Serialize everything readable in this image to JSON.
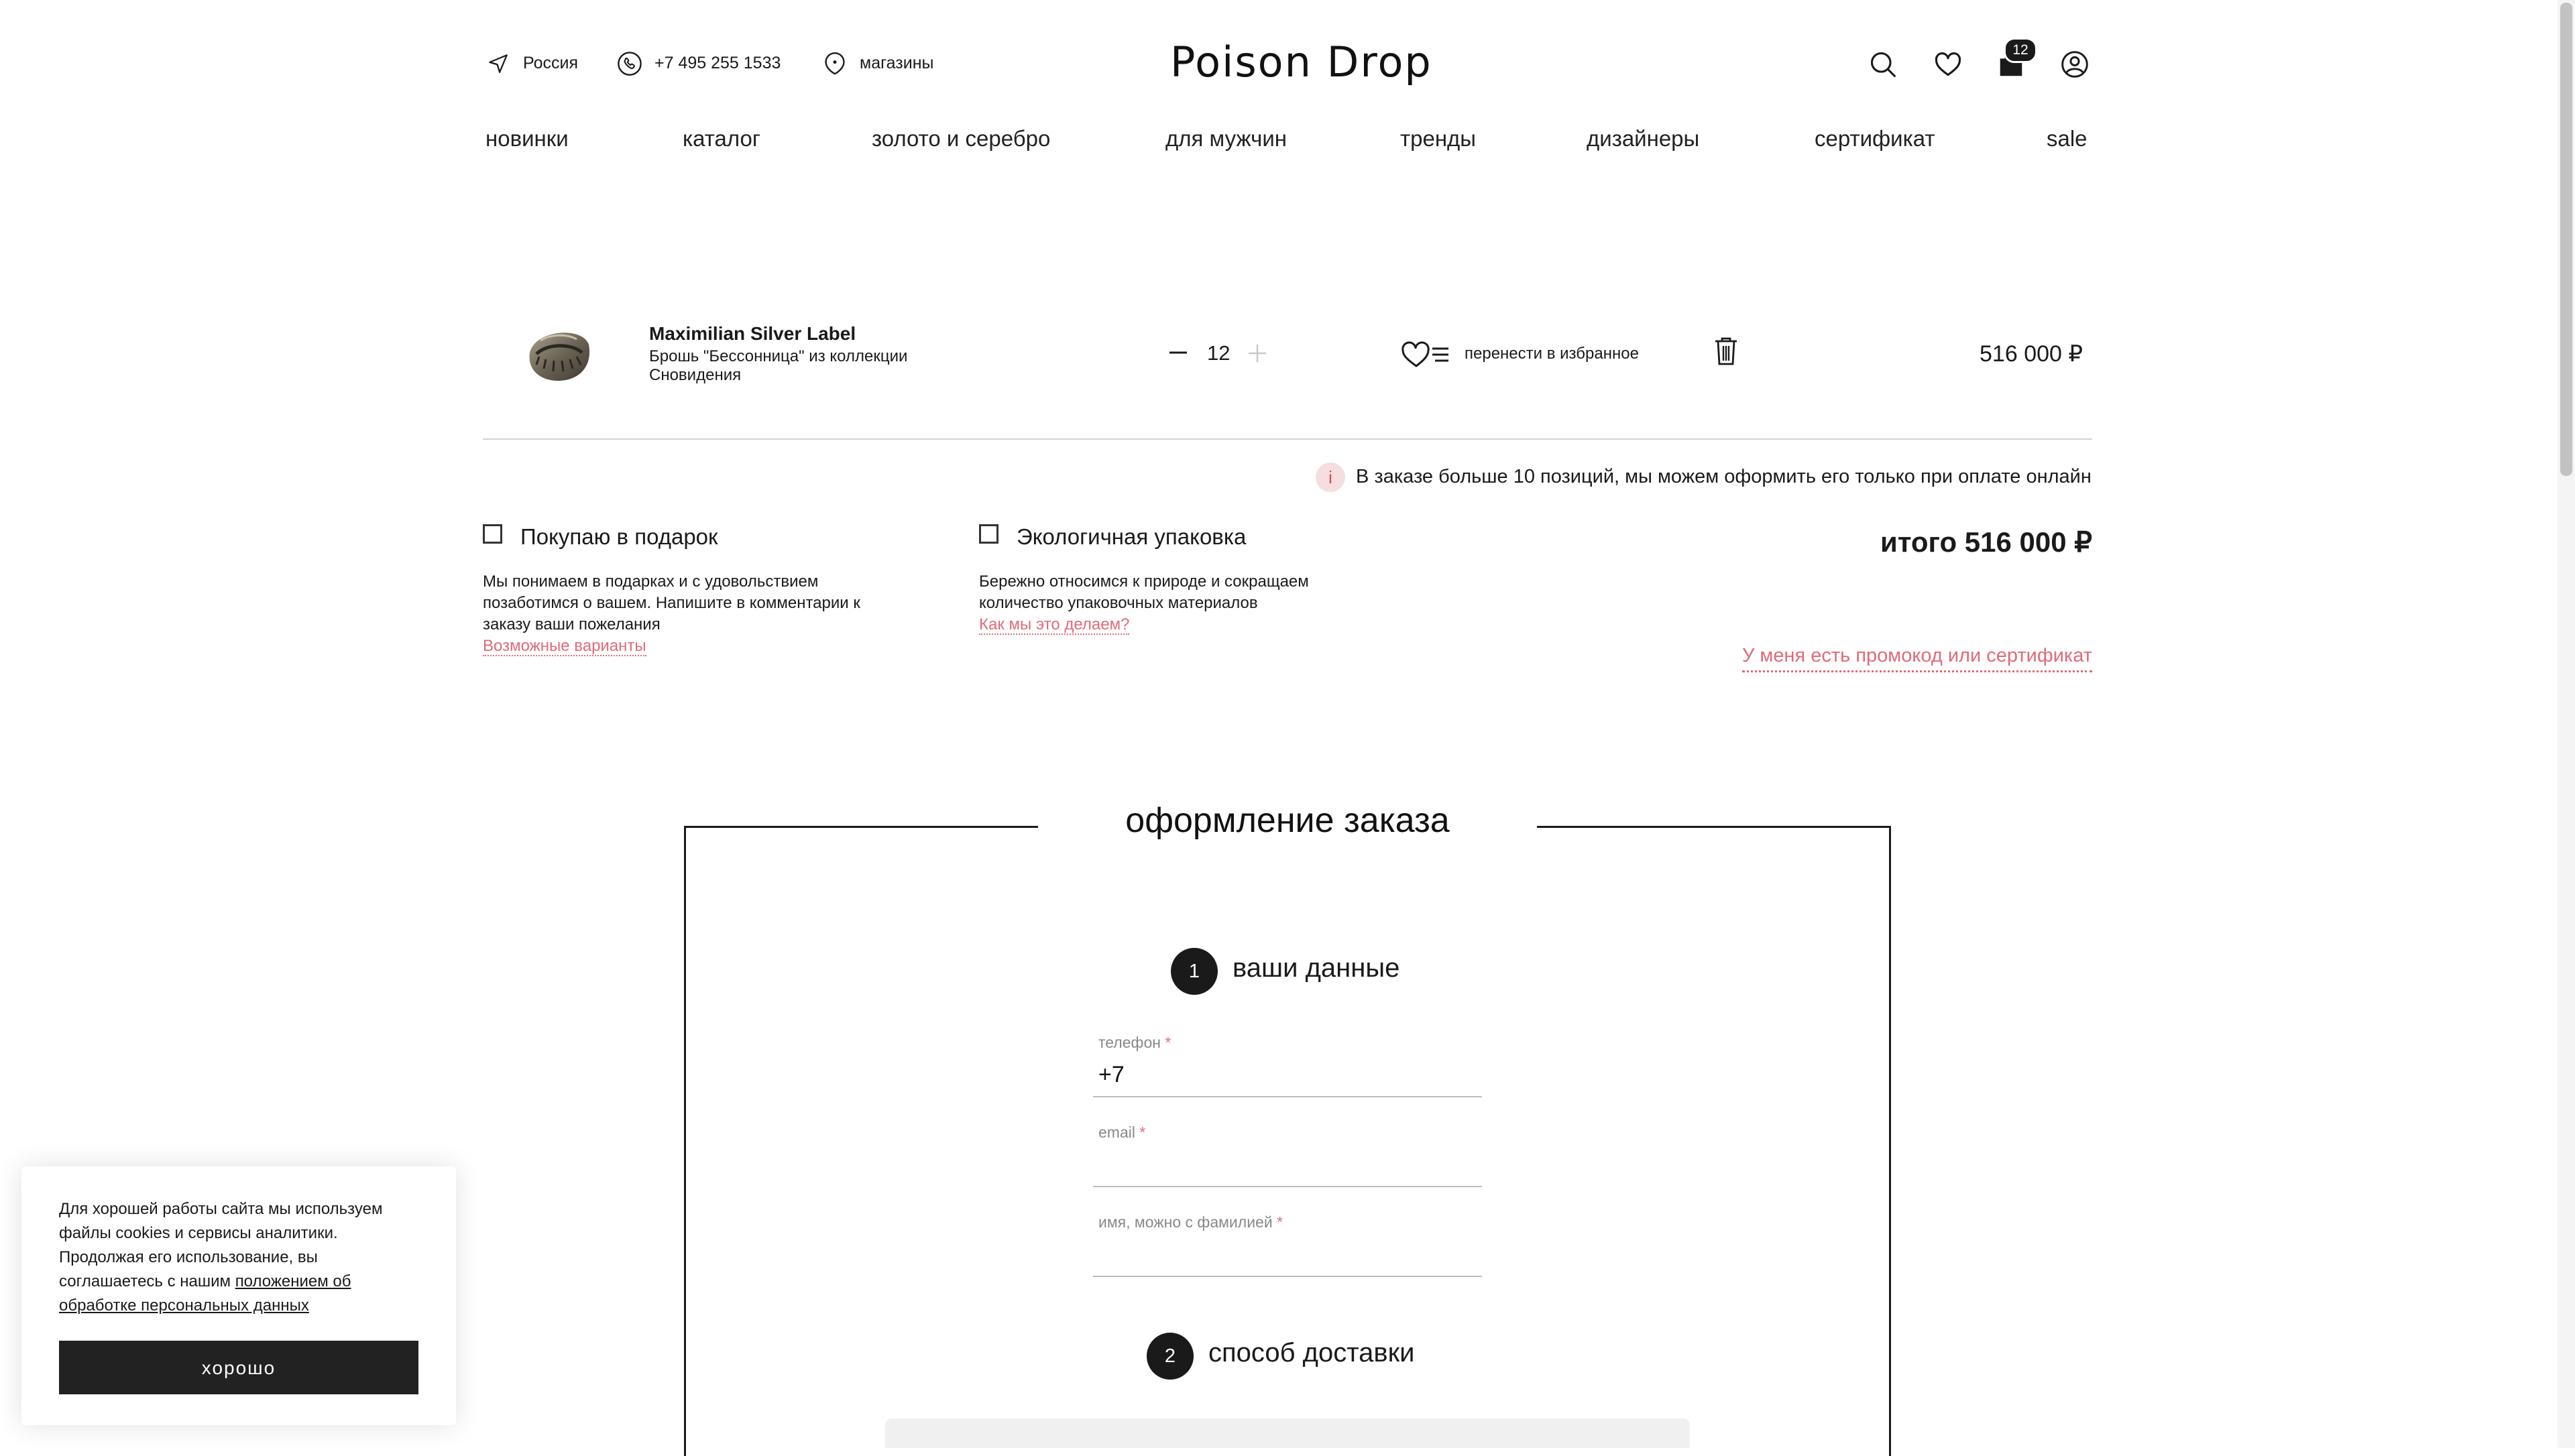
{
  "header": {
    "region": "Россия",
    "phone": "+7 495 255 1533",
    "stores": "магазины",
    "logo": "Poison Drop",
    "cart_count": "12"
  },
  "nav": [
    "новинки",
    "каталог",
    "золото и серебро",
    "для мужчин",
    "тренды",
    "дизайнеры",
    "сертификат",
    "sale"
  ],
  "cart": {
    "item": {
      "brand": "Maximilian Silver Label",
      "desc_line1": "Брошь \"Бессонница\" из коллекции",
      "desc_line2": "Сновидения",
      "qty": "12",
      "move_to_favorites": "перенести в избранное",
      "price": "516 000 ₽"
    },
    "notice": "В заказе больше 10 позиций, мы можем оформить его только при оплате онлайн",
    "notice_icon": "i",
    "gift": {
      "label": "Покупаю в подарок",
      "line1": "Мы понимаем в подарках и с удовольствием",
      "line2": "позаботимся о вашем. Напишите в комментарии к",
      "line3": "заказу ваши пожелания",
      "link": "Возможные варианты"
    },
    "eco": {
      "label": "Экологичная упаковка",
      "line1": "Бережно относимся к природе и сокращаем",
      "line2": "количество упаковочных материалов",
      "link": "Как мы это делаем?"
    },
    "total": "итого 516 000 ₽",
    "promo": "У меня есть промокод или сертификат"
  },
  "order": {
    "title": "оформление заказа",
    "step1": {
      "num": "1",
      "title": "ваши данные"
    },
    "fields": {
      "phone": {
        "label": "телефон",
        "value": "+7"
      },
      "email": {
        "label": "email",
        "value": ""
      },
      "name": {
        "label": "имя, можно с фамилией",
        "value": ""
      },
      "required_mark": "*"
    },
    "step2": {
      "num": "2",
      "title": "способ доставки"
    }
  },
  "cookies": {
    "line1": "Для хорошей работы сайта мы используем",
    "line2": "файлы cookies и сервисы аналитики.",
    "line3": "Продолжая его использование, вы",
    "line4": "соглашаетесь с нашим ",
    "link1": "положением об",
    "link2": "обработке персональных данных",
    "button": "хорошо"
  },
  "colors": {
    "accent": "#e06b78",
    "dark": "#1a1a1a",
    "notice_bg": "#f6dde0"
  }
}
